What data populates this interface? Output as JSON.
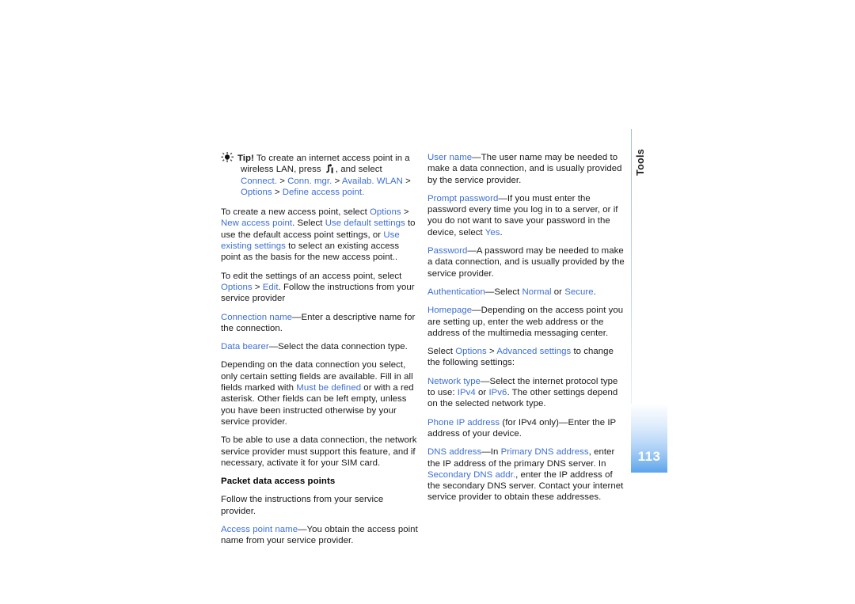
{
  "page": {
    "number": "113",
    "section_tab": "Tools",
    "accent_blue": "#3d6fd1",
    "page_block_blue": "#5aa3ec"
  },
  "icons": {
    "tip": "tip-bulb-icon",
    "menu_key": "nokia-menu-key-icon"
  },
  "left_column": {
    "tip": {
      "label": "Tip!",
      "line1": "To create an internet access point in a wireless",
      "line2a": "LAN, press",
      "line2b": ", and select",
      "ui1": "Connect.",
      "sep1": ">",
      "ui2": "Conn. mgr.",
      "sep2": ">",
      "ui3": "Availab. WLAN",
      "sep3": ">",
      "ui4": "Options",
      "sep4": ">",
      "ui5": "Define access point."
    },
    "p_new_access_point": {
      "t1": "To create a new access point, select ",
      "ui1": "Options",
      "t2": " > ",
      "ui2": "New access point",
      "t3": ". Select ",
      "ui3": "Use default settings",
      "t4": " to use the default access point settings, or ",
      "ui4": "Use existing settings",
      "t5": " to select an existing access point as the basis for the new access point.."
    },
    "p_edit": {
      "t1": "To edit the settings of an access point, select ",
      "ui1": "Options",
      "t2": " > ",
      "ui2": "Edit",
      "t3": ". Follow the instructions from your service provider"
    },
    "p_connection_name": {
      "ui1": "Connection name",
      "t1": "—Enter a descriptive name for the connection."
    },
    "p_data_bearer": {
      "ui1": "Data bearer",
      "t1": "—Select the data connection type."
    },
    "p_depending": {
      "t1": "Depending on the data connection you select, only certain setting fields are available. Fill in all fields marked with ",
      "ui1": "Must be defined",
      "t2": " or with a red asterisk. Other fields can be left empty, unless you have been instructed otherwise by your service provider."
    },
    "p_to_be_able": {
      "t1": "To be able to use a data connection, the network service provider must support this feature, and if necessary, activate it for your SIM card."
    },
    "heading_packet_data": "Packet data access points",
    "p_follow": {
      "t1": "Follow the instructions from your service provider."
    },
    "p_access_point_name": {
      "ui1": "Access point name",
      "t1": "—You obtain the access point name from your service provider."
    }
  },
  "right_column": {
    "p_user_name": {
      "ui1": "User name",
      "t1": "—The user name may be needed to make a data connection, and is usually provided by the service provider."
    },
    "p_prompt_password": {
      "ui1": "Prompt password",
      "t1": "—If you must enter the password every time you log in to a server, or if you do not want to save your password in the device, select ",
      "ui2": "Yes",
      "t2": "."
    },
    "p_password": {
      "ui1": "Password",
      "t1": "—A password may be needed to make a data connection, and is usually provided by the service provider."
    },
    "p_authentication": {
      "ui1": "Authentication",
      "t1": "—Select ",
      "ui2": "Normal",
      "t2": " or ",
      "ui3": "Secure",
      "t3": "."
    },
    "p_homepage": {
      "ui1": "Homepage",
      "t1": "—Depending on the access point you are setting up, enter the web address or the address of the multimedia messaging center."
    },
    "p_select_options": {
      "t1": "Select ",
      "ui1": "Options",
      "t2": " > ",
      "ui2": "Advanced settings",
      "t3": " to change the following settings:"
    },
    "p_network_type": {
      "ui1": "Network type",
      "t1": "—Select the internet protocol type to use: ",
      "ui2": "IPv4",
      "t2": " or ",
      "ui3": "IPv6",
      "t3": ". The other settings depend on the selected network type."
    },
    "p_phone_ip": {
      "ui1": "Phone IP address",
      "t1": " (for IPv4 only)—Enter the IP address of your device."
    },
    "p_dns": {
      "ui1": "DNS address",
      "t1": "—In ",
      "ui2": "Primary DNS address",
      "t2": ", enter the IP address of the primary DNS server. In ",
      "ui3": "Secondary DNS addr.",
      "t3": ", enter the IP address of the secondary DNS server. Contact your internet service provider to obtain these addresses."
    }
  }
}
